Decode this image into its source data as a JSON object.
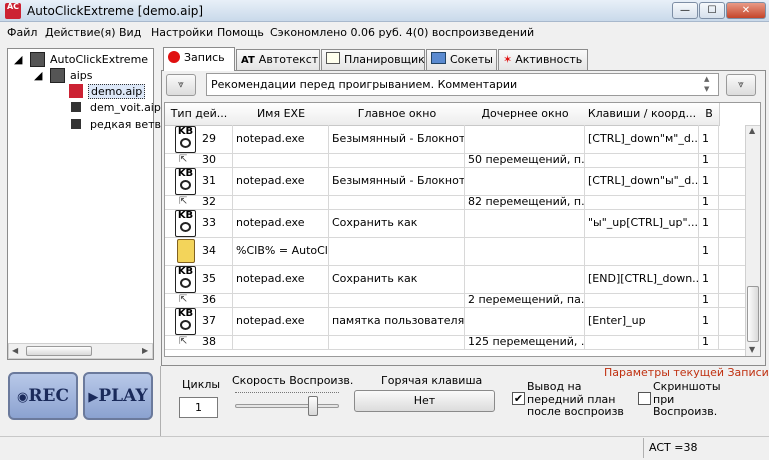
{
  "window": {
    "title": "AutoClickExtreme [demo.aip]",
    "icon_text": "AC",
    "controls": {
      "minimize": "—",
      "maximize": "☐",
      "close": "✕"
    }
  },
  "menu": {
    "items": [
      "Файл",
      "Действие(я)",
      "Вид",
      "Настройки",
      "Помощь"
    ],
    "savings": "Сэкономлено 0.06 руб. 4(0) воспроизведений"
  },
  "tree": {
    "root": "AutoClickExtreme",
    "folder": "aips",
    "files": [
      "demo.aip",
      "dem_voit.aip",
      "редкая ветв"
    ],
    "selected": "demo.aip"
  },
  "buttons": {
    "rec": "REC",
    "play": "PLAY"
  },
  "tabs": [
    {
      "label": "Запись",
      "icon": "record-dot-icon"
    },
    {
      "label": "Автотекст",
      "icon": "at-icon"
    },
    {
      "label": "Планировщик",
      "icon": "scheduler-icon"
    },
    {
      "label": "Сокеты",
      "icon": "sockets-icon"
    },
    {
      "label": "Активность",
      "icon": "activity-icon"
    }
  ],
  "tab_icon_texts": {
    "at": "AT"
  },
  "comment": "Рекомендации перед проигрыванием. Комментарии",
  "table": {
    "headers": [
      "Тип дей...",
      "Имя EXE",
      "Главное окно",
      "Дочернее окно",
      "Клавиши / коорд...",
      "В"
    ],
    "rows": [
      {
        "type": "keyboard",
        "num": "29",
        "exe": "notepad.exe",
        "main": "Безымянный - Блокнот",
        "child": "",
        "keys": "[CTRL]_down\"м\"_d...",
        "v": "1"
      },
      {
        "type": "mouse",
        "num": "30",
        "exe": "",
        "main": "",
        "child": "50 перемещений, п...",
        "keys": "",
        "v": "1"
      },
      {
        "type": "keyboard",
        "num": "31",
        "exe": "notepad.exe",
        "main": "Безымянный - Блокнот",
        "child": "",
        "keys": "[CTRL]_down\"ы\"_d...",
        "v": "1"
      },
      {
        "type": "mouse",
        "num": "32",
        "exe": "",
        "main": "",
        "child": "82 перемещений, п...",
        "keys": "",
        "v": "1"
      },
      {
        "type": "keyboard",
        "num": "33",
        "exe": "notepad.exe",
        "main": "Сохранить как",
        "child": "",
        "keys": "\"ы\"_up[CTRL]_up\"...",
        "v": "1"
      },
      {
        "type": "clipboard",
        "num": "34",
        "exe": "%CIB% = AutoCli...",
        "main": "",
        "child": "",
        "keys": "",
        "v": "1"
      },
      {
        "type": "keyboard",
        "num": "35",
        "exe": "notepad.exe",
        "main": "Сохранить как",
        "child": "",
        "keys": "[END][CTRL]_down...",
        "v": "1"
      },
      {
        "type": "mouse",
        "num": "36",
        "exe": "",
        "main": "",
        "child": "2 перемещений, па...",
        "keys": "",
        "v": "1"
      },
      {
        "type": "keyboard",
        "num": "37",
        "exe": "notepad.exe",
        "main": "памятка пользователя...",
        "child": "",
        "keys": "[Enter]_up",
        "v": "1"
      },
      {
        "type": "mouse",
        "num": "38",
        "exe": "",
        "main": "",
        "child": "125 перемещений, ...",
        "keys": "",
        "v": "1"
      }
    ],
    "kb_top": "KB"
  },
  "settings": {
    "link": "Параметры текущей Записи",
    "cycles_label": "Циклы",
    "cycles_value": "1",
    "speed_label": "Скорость Воспроизв.",
    "speed_level": 0.78,
    "hotkey_label": "Горячая клавиша",
    "hotkey_value": "Нет",
    "foreground_label_1": "Вывод на",
    "foreground_label_2": "передний план",
    "foreground_label_3": "после воспроизв",
    "foreground_checked": true,
    "screens_label_1": "Скриншоты",
    "screens_label_2": "при",
    "screens_label_3": "Воспроизв.",
    "screens_checked": false
  },
  "status": {
    "act": "ACT =38"
  },
  "colors": {
    "record": "#e01010",
    "link": "#c03010"
  }
}
